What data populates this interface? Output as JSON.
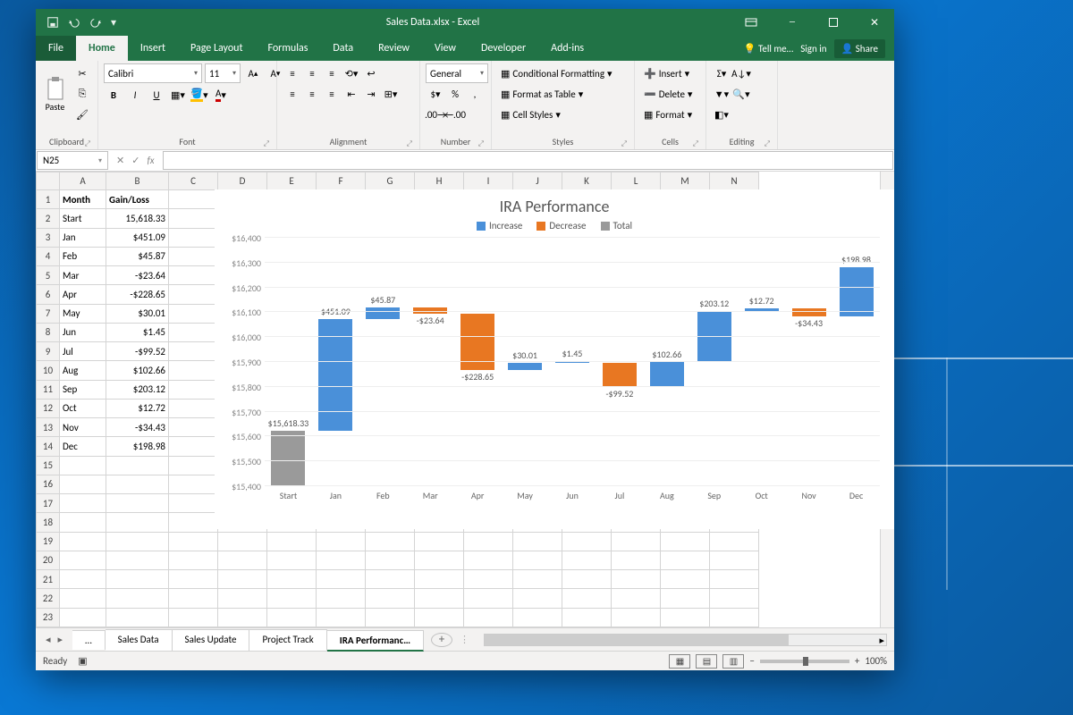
{
  "title": "Sales Data.xlsx - Excel",
  "tabs": [
    "File",
    "Home",
    "Insert",
    "Page Layout",
    "Formulas",
    "Data",
    "Review",
    "View",
    "Developer",
    "Add-ins"
  ],
  "active_tab": "Home",
  "tell_me": "Tell me…",
  "sign_in": "Sign in",
  "share": "Share",
  "ribbon": {
    "clipboard": {
      "label": "Clipboard",
      "paste": "Paste"
    },
    "font": {
      "label": "Font",
      "name": "Calibri",
      "size": "11",
      "buttons": [
        "B",
        "I",
        "U"
      ]
    },
    "alignment": {
      "label": "Alignment"
    },
    "number": {
      "label": "Number",
      "format": "General"
    },
    "styles": {
      "label": "Styles",
      "cf": "Conditional Formatting",
      "table": "Format as Table",
      "cell": "Cell Styles"
    },
    "cells": {
      "label": "Cells",
      "insert": "Insert",
      "delete": "Delete",
      "format": "Format"
    },
    "editing": {
      "label": "Editing"
    }
  },
  "name_box": "N25",
  "columns": [
    "A",
    "B",
    "C",
    "D",
    "E",
    "F",
    "G",
    "H",
    "I",
    "J",
    "K",
    "L",
    "M",
    "N"
  ],
  "rows": 23,
  "spreadsheet": {
    "headers": [
      "Month",
      "Gain/Loss"
    ],
    "data": [
      [
        "Start",
        "15,618.33"
      ],
      [
        "Jan",
        "$451.09"
      ],
      [
        "Feb",
        "$45.87"
      ],
      [
        "Mar",
        "-$23.64"
      ],
      [
        "Apr",
        "-$228.65"
      ],
      [
        "May",
        "$30.01"
      ],
      [
        "Jun",
        "$1.45"
      ],
      [
        "Jul",
        "-$99.52"
      ],
      [
        "Aug",
        "$102.66"
      ],
      [
        "Sep",
        "$203.12"
      ],
      [
        "Oct",
        "$12.72"
      ],
      [
        "Nov",
        "-$34.43"
      ],
      [
        "Dec",
        "$198.98"
      ]
    ]
  },
  "sheet_tabs": [
    "Sales Data",
    "Sales Update",
    "Project Track",
    "IRA Performanc…"
  ],
  "active_sheet": 3,
  "ellipsis_tab": "…",
  "status": "Ready",
  "zoom": "100%",
  "chart_data": {
    "type": "waterfall",
    "title": "IRA Performance",
    "legend": [
      {
        "name": "Increase",
        "color": "#4a90d9"
      },
      {
        "name": "Decrease",
        "color": "#e87722"
      },
      {
        "name": "Total",
        "color": "#9a9a9a"
      }
    ],
    "ylabel": "",
    "ylim": [
      15400,
      16400
    ],
    "yticks": [
      "$15,400",
      "$15,500",
      "$15,600",
      "$15,700",
      "$15,800",
      "$15,900",
      "$16,000",
      "$16,100",
      "$16,200",
      "$16,300",
      "$16,400"
    ],
    "categories": [
      "Start",
      "Jan",
      "Feb",
      "Mar",
      "Apr",
      "May",
      "Jun",
      "Jul",
      "Aug",
      "Sep",
      "Oct",
      "Nov",
      "Dec"
    ],
    "series": [
      {
        "cat": "Start",
        "type": "total",
        "value": 15618.33,
        "label": "$15,618.33",
        "cum_start": 15400,
        "cum_end": 15618.33
      },
      {
        "cat": "Jan",
        "type": "increase",
        "value": 451.09,
        "label": "$451.09",
        "cum_start": 15618.33,
        "cum_end": 16069.42
      },
      {
        "cat": "Feb",
        "type": "increase",
        "value": 45.87,
        "label": "$45.87",
        "cum_start": 16069.42,
        "cum_end": 16115.29
      },
      {
        "cat": "Mar",
        "type": "decrease",
        "value": -23.64,
        "label": "-$23.64",
        "cum_start": 16115.29,
        "cum_end": 16091.65
      },
      {
        "cat": "Apr",
        "type": "decrease",
        "value": -228.65,
        "label": "-$228.65",
        "cum_start": 16091.65,
        "cum_end": 15863.0
      },
      {
        "cat": "May",
        "type": "increase",
        "value": 30.01,
        "label": "$30.01",
        "cum_start": 15863.0,
        "cum_end": 15893.01
      },
      {
        "cat": "Jun",
        "type": "increase",
        "value": 1.45,
        "label": "$1.45",
        "cum_start": 15893.01,
        "cum_end": 15894.46
      },
      {
        "cat": "Jul",
        "type": "decrease",
        "value": -99.52,
        "label": "-$99.52",
        "cum_start": 15894.46,
        "cum_end": 15794.94
      },
      {
        "cat": "Aug",
        "type": "increase",
        "value": 102.66,
        "label": "$102.66",
        "cum_start": 15794.94,
        "cum_end": 15897.6
      },
      {
        "cat": "Sep",
        "type": "increase",
        "value": 203.12,
        "label": "$203.12",
        "cum_start": 15897.6,
        "cum_end": 16100.72
      },
      {
        "cat": "Oct",
        "type": "increase",
        "value": 12.72,
        "label": "$12.72",
        "cum_start": 16100.72,
        "cum_end": 16113.44
      },
      {
        "cat": "Nov",
        "type": "decrease",
        "value": -34.43,
        "label": "-$34.43",
        "cum_start": 16113.44,
        "cum_end": 16079.01
      },
      {
        "cat": "Dec",
        "type": "increase",
        "value": 198.98,
        "label": "$198.98",
        "cum_start": 16079.01,
        "cum_end": 16277.99
      }
    ]
  }
}
